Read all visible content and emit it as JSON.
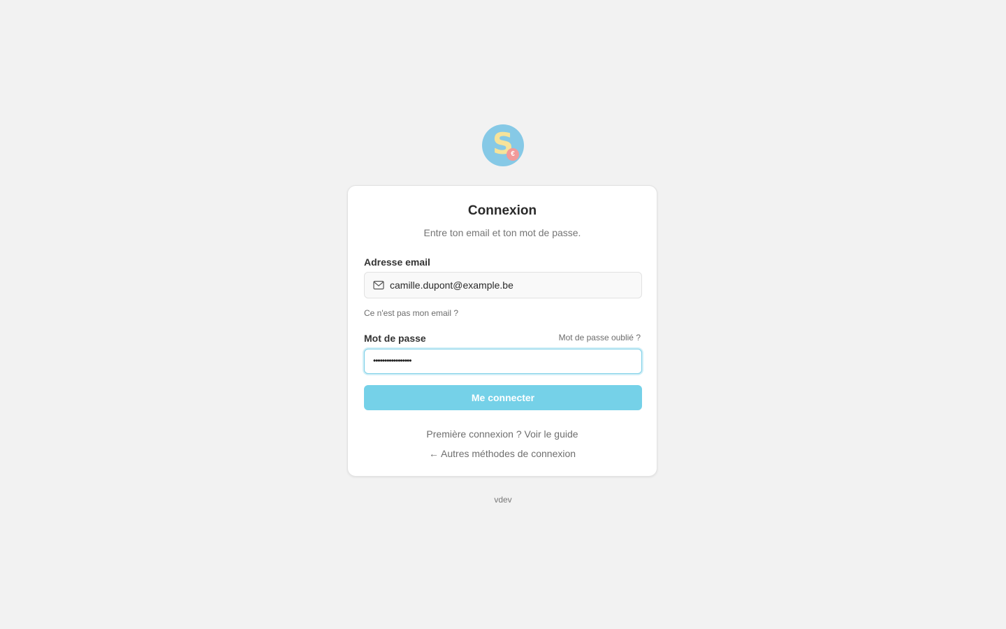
{
  "logo": {
    "letter": "S",
    "badge": "€",
    "colors": {
      "background": "#86c9e6",
      "letter": "#f6e39a",
      "badge": "#f29a9a"
    }
  },
  "login": {
    "title": "Connexion",
    "subtitle": "Entre ton email et ton mot de passe.",
    "email": {
      "label": "Adresse email",
      "value": "camille.dupont@example.be",
      "icon": "mail-icon",
      "not_my_email": "Ce n'est pas mon email ?"
    },
    "password": {
      "label": "Mot de passe",
      "forgot": "Mot de passe oublié ?",
      "masked_value": "•••••••••••••••••"
    },
    "submit_label": "Me connecter",
    "first_login": "Première connexion ? Voir le guide",
    "other_methods": "← Autres méthodes de connexion"
  },
  "footer": {
    "version": "vdev"
  },
  "colors": {
    "page_background": "#f2f2f2",
    "accent": "#75d1e8",
    "focus_border": "#7fd0e8"
  }
}
